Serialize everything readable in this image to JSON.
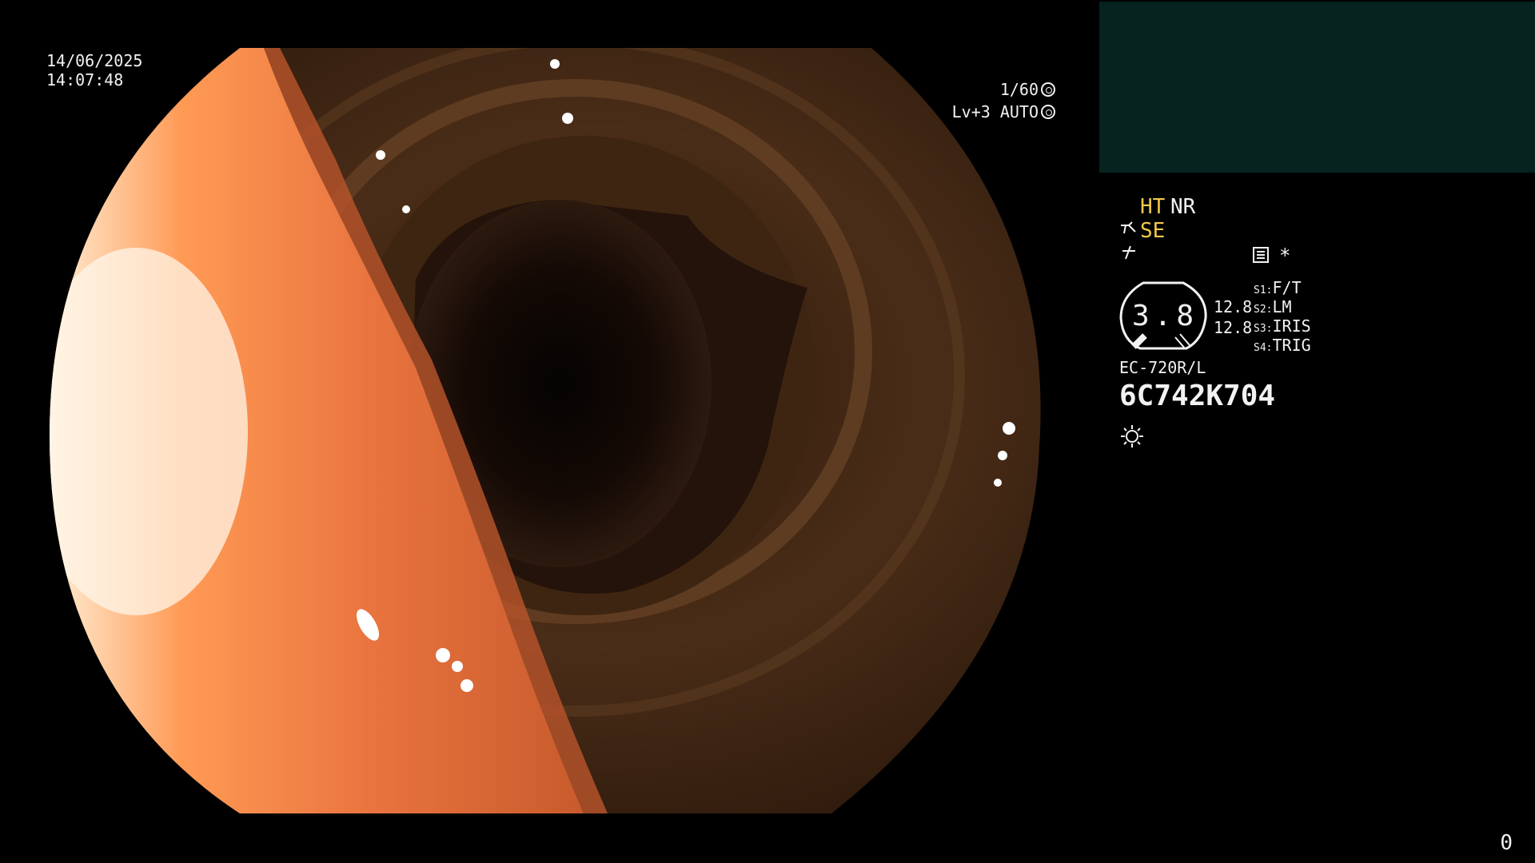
{
  "overlay": {
    "date": "14/06/2025",
    "time": "14:07:48",
    "shutter": "1/60",
    "enhancement": "Lv+3 AUTO",
    "corner_number": "0"
  },
  "side_panel": {
    "ht": "HT",
    "nr": "NR",
    "se": "SE",
    "dial_value": "3.8",
    "dial_left_values": [
      "12.8",
      "12.8"
    ],
    "switches": [
      {
        "key": "S1",
        "label": "F/T"
      },
      {
        "key": "S2",
        "label": "LM"
      },
      {
        "key": "S3",
        "label": "IRIS"
      },
      {
        "key": "S4",
        "label": "TRIG"
      }
    ],
    "star": "*",
    "scope_model": "EC-720R/L",
    "serial": "6C742K704"
  },
  "colors": {
    "background": "#000000",
    "text": "#f2f2f2",
    "highlight": "#f2c94a",
    "thumbnail_panel": "#062320"
  },
  "icons": [
    "shutter-icon",
    "auto-iris-icon",
    "scope-icon",
    "flash-off-icon",
    "document-icon",
    "light-source-icon"
  ]
}
